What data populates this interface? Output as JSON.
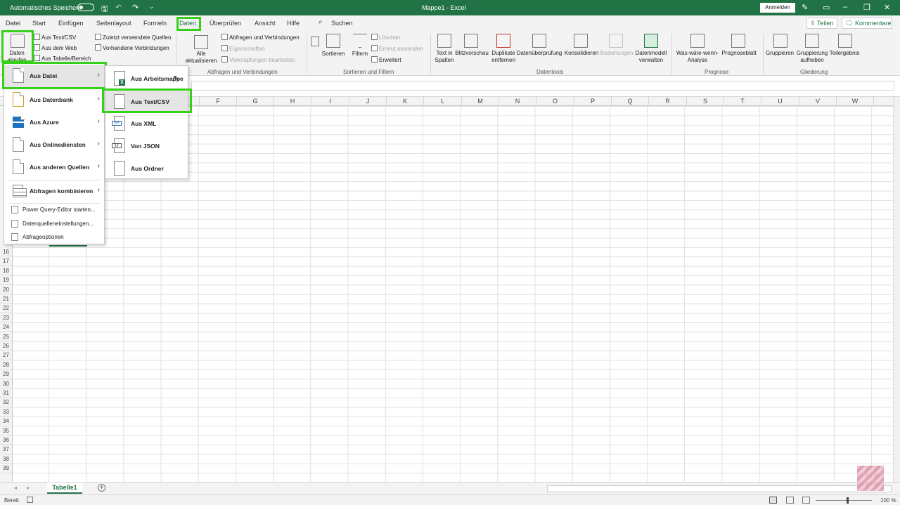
{
  "titlebar": {
    "autosave_label": "Automatisches Speichern",
    "doc_title": "Mappe1 - Excel",
    "signin_label": "Anmelden"
  },
  "tabs": [
    {
      "label": "Datei"
    },
    {
      "label": "Start"
    },
    {
      "label": "Einfügen"
    },
    {
      "label": "Seitenlayout"
    },
    {
      "label": "Formeln"
    },
    {
      "label": "Daten"
    },
    {
      "label": "Überprüfen"
    },
    {
      "label": "Ansicht"
    },
    {
      "label": "Hilfe"
    }
  ],
  "search_label": "Suchen",
  "share_label": "Teilen",
  "comments_label": "Kommentare",
  "ribbon": {
    "get_data": "Daten abrufen",
    "from_text_csv": "Aus Text/CSV",
    "from_web": "Aus dem Web",
    "from_table": "Aus Tabelle/Bereich",
    "recent_sources": "Zuletzt verwendete Quellen",
    "existing_connections": "Vorhandene Verbindungen",
    "refresh_all_1": "Alle",
    "refresh_all_2": "aktualisieren",
    "queries_connections": "Abfragen und Verbindungen",
    "properties": "Eigenschaften",
    "edit_links": "Verknüpfungen bearbeiten",
    "group_queries": "Abfragen und Verbindungen",
    "sort": "Sortieren",
    "filter": "Filtern",
    "clear": "Löschen",
    "reapply": "Erneut anwenden",
    "advanced": "Erweitert",
    "group_sort": "Sortieren und Filtern",
    "text_to_columns_1": "Text in",
    "text_to_columns_2": "Spalten",
    "flash_fill": "Blitzvorschau",
    "remove_dupes_1": "Duplikate",
    "remove_dupes_2": "entfernen",
    "data_validation": "Datenüberprüfung",
    "consolidate": "Konsolidieren",
    "relationships": "Beziehungen",
    "data_model_1": "Datenmodell",
    "data_model_2": "verwalten",
    "group_datatools": "Datentools",
    "what_if_1": "Was-wäre-wenn-",
    "what_if_2": "Analyse",
    "forecast_sheet": "Prognoseblatt",
    "group_forecast": "Prognose",
    "group": "Gruppieren",
    "ungroup_1": "Gruppierung",
    "ungroup_2": "aufheben",
    "subtotal": "Teilergebnis",
    "group_outline": "Gliederung"
  },
  "columns": [
    "F",
    "G",
    "H",
    "I",
    "J",
    "K",
    "L",
    "M",
    "N",
    "O",
    "P",
    "Q",
    "R",
    "S",
    "T",
    "U",
    "V",
    "W"
  ],
  "rows": [
    "16",
    "17",
    "18",
    "19",
    "20",
    "21",
    "22",
    "23",
    "24",
    "25",
    "26",
    "27",
    "28",
    "29",
    "30",
    "31",
    "32",
    "33",
    "34",
    "35",
    "36",
    "37",
    "38",
    "39"
  ],
  "menu1": {
    "items": [
      {
        "label": "Aus Datei"
      },
      {
        "label": "Aus Datenbank"
      },
      {
        "label": "Aus Azure"
      },
      {
        "label": "Aus Onlinediensten"
      },
      {
        "label": "Aus anderen Quellen"
      },
      {
        "label": "Abfragen kombinieren"
      }
    ],
    "small": [
      {
        "label": "Power Query-Editor starten..."
      },
      {
        "label": "Datenquelleneinstellungen..."
      },
      {
        "label": "Abfrageoptionen"
      }
    ]
  },
  "menu2": {
    "items": [
      {
        "label": "Aus Arbeitsmappe"
      },
      {
        "label": "Aus Text/CSV"
      },
      {
        "label": "Aus XML"
      },
      {
        "label": "Von JSON"
      },
      {
        "label": "Aus Ordner"
      }
    ]
  },
  "sheet_tab": "Tabelle1",
  "status_ready": "Bereit",
  "zoom_level": "100 %",
  "colors": {
    "accent": "#217346",
    "highlight": "#36d01b"
  }
}
